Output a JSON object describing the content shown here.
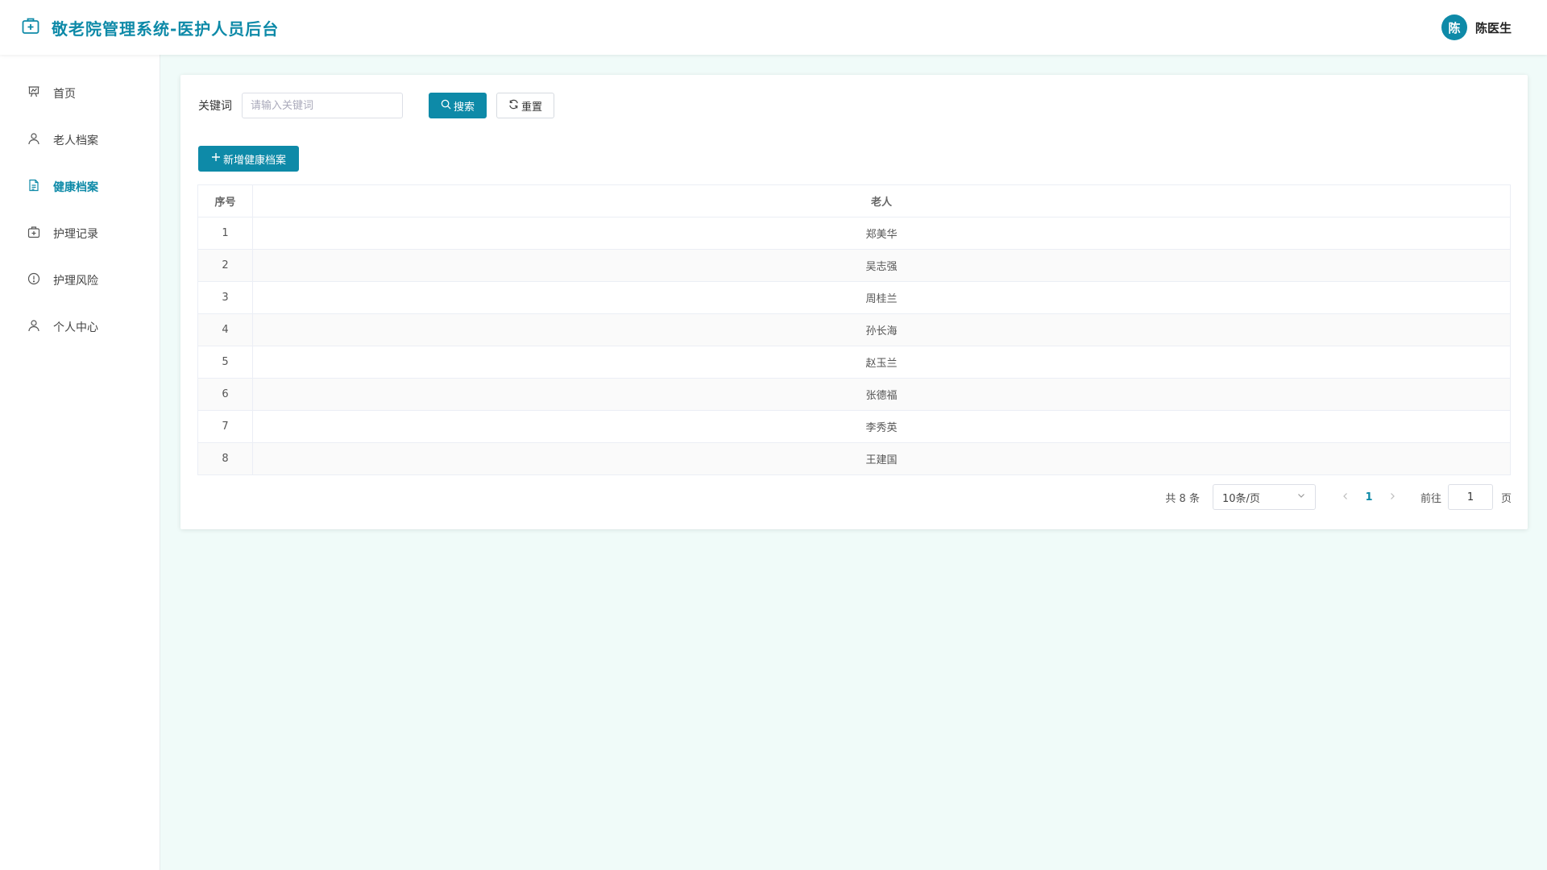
{
  "header": {
    "title": "敬老院管理系统-医护人员后台",
    "avatar_text": "陈",
    "username": "陈医生"
  },
  "sidebar": {
    "items": [
      {
        "label": "首页",
        "icon": "presentation-chart-icon"
      },
      {
        "label": "老人档案",
        "icon": "user-icon"
      },
      {
        "label": "健康档案",
        "icon": "document-icon",
        "active": true
      },
      {
        "label": "护理记录",
        "icon": "first-aid-kit-icon"
      },
      {
        "label": "护理风险",
        "icon": "warning-circle-icon"
      },
      {
        "label": "个人中心",
        "icon": "user-icon"
      }
    ]
  },
  "search": {
    "label": "关键词",
    "placeholder": "请输入关键词",
    "value": "",
    "search_button": "搜索",
    "reset_button": "重置"
  },
  "toolbar": {
    "add_button": "新增健康档案"
  },
  "table": {
    "columns": [
      "序号",
      "老人"
    ],
    "rows": [
      {
        "no": "1",
        "name": "郑美华"
      },
      {
        "no": "2",
        "name": "吴志强"
      },
      {
        "no": "3",
        "name": "周桂兰"
      },
      {
        "no": "4",
        "name": "孙长海"
      },
      {
        "no": "5",
        "name": "赵玉兰"
      },
      {
        "no": "6",
        "name": "张德福"
      },
      {
        "no": "7",
        "name": "李秀英"
      },
      {
        "no": "8",
        "name": "王建国"
      }
    ]
  },
  "pagination": {
    "total_text": "共 8 条",
    "page_size": "10条/页",
    "current_page": "1",
    "goto_label": "前往",
    "goto_value": "1",
    "page_suffix": "页"
  },
  "colors": {
    "accent": "#0e8aa8",
    "background": "#f0fbf9"
  }
}
